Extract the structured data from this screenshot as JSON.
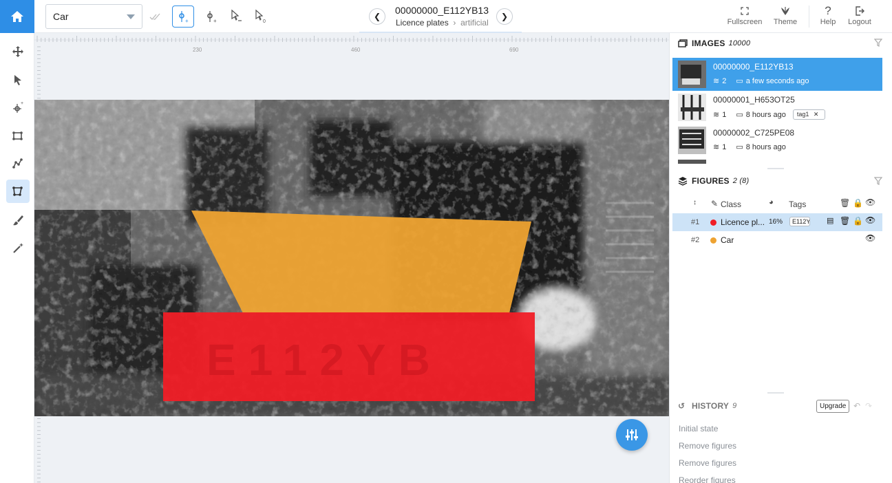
{
  "toolbar": {
    "class_value": "Car",
    "image_title": "00000000_E112YB13",
    "project": "Licence plates",
    "dataset": "artificial",
    "fullscreen_label": "Fullscreen",
    "theme_label": "Theme",
    "help_label": "Help",
    "logout_label": "Logout",
    "accent": "#2e8ee6"
  },
  "ruler": {
    "ticks": [
      "230",
      "460",
      "690"
    ]
  },
  "images": {
    "title": "IMAGES",
    "count": "10000",
    "items": [
      {
        "name": "00000000_E112YB13",
        "figures": "2",
        "time": "a few seconds ago",
        "tag": ""
      },
      {
        "name": "00000001_H653OT25",
        "figures": "1",
        "time": "8 hours ago",
        "tag": "tag1"
      },
      {
        "name": "00000002_C725PE08",
        "figures": "1",
        "time": "8 hours ago",
        "tag": ""
      }
    ]
  },
  "figures": {
    "title": "FIGURES",
    "count": "2 (8)",
    "col_class": "Class",
    "col_tags": "Tags",
    "rows": [
      {
        "num": "#1",
        "class": "Licence pl...",
        "pct": "16%",
        "tag": "E112Y",
        "color": "#f01e26"
      },
      {
        "num": "#2",
        "class": "Car",
        "pct": "",
        "tag": "",
        "color": "#eea332"
      }
    ]
  },
  "history": {
    "title": "HISTORY",
    "count": "9",
    "upgrade_label": "Upgrade",
    "items": [
      "Initial state",
      "Remove figures",
      "Remove figures",
      "Reorder figures"
    ]
  },
  "annotation_colors": {
    "car": "#eea332",
    "plate": "#f01e26"
  }
}
